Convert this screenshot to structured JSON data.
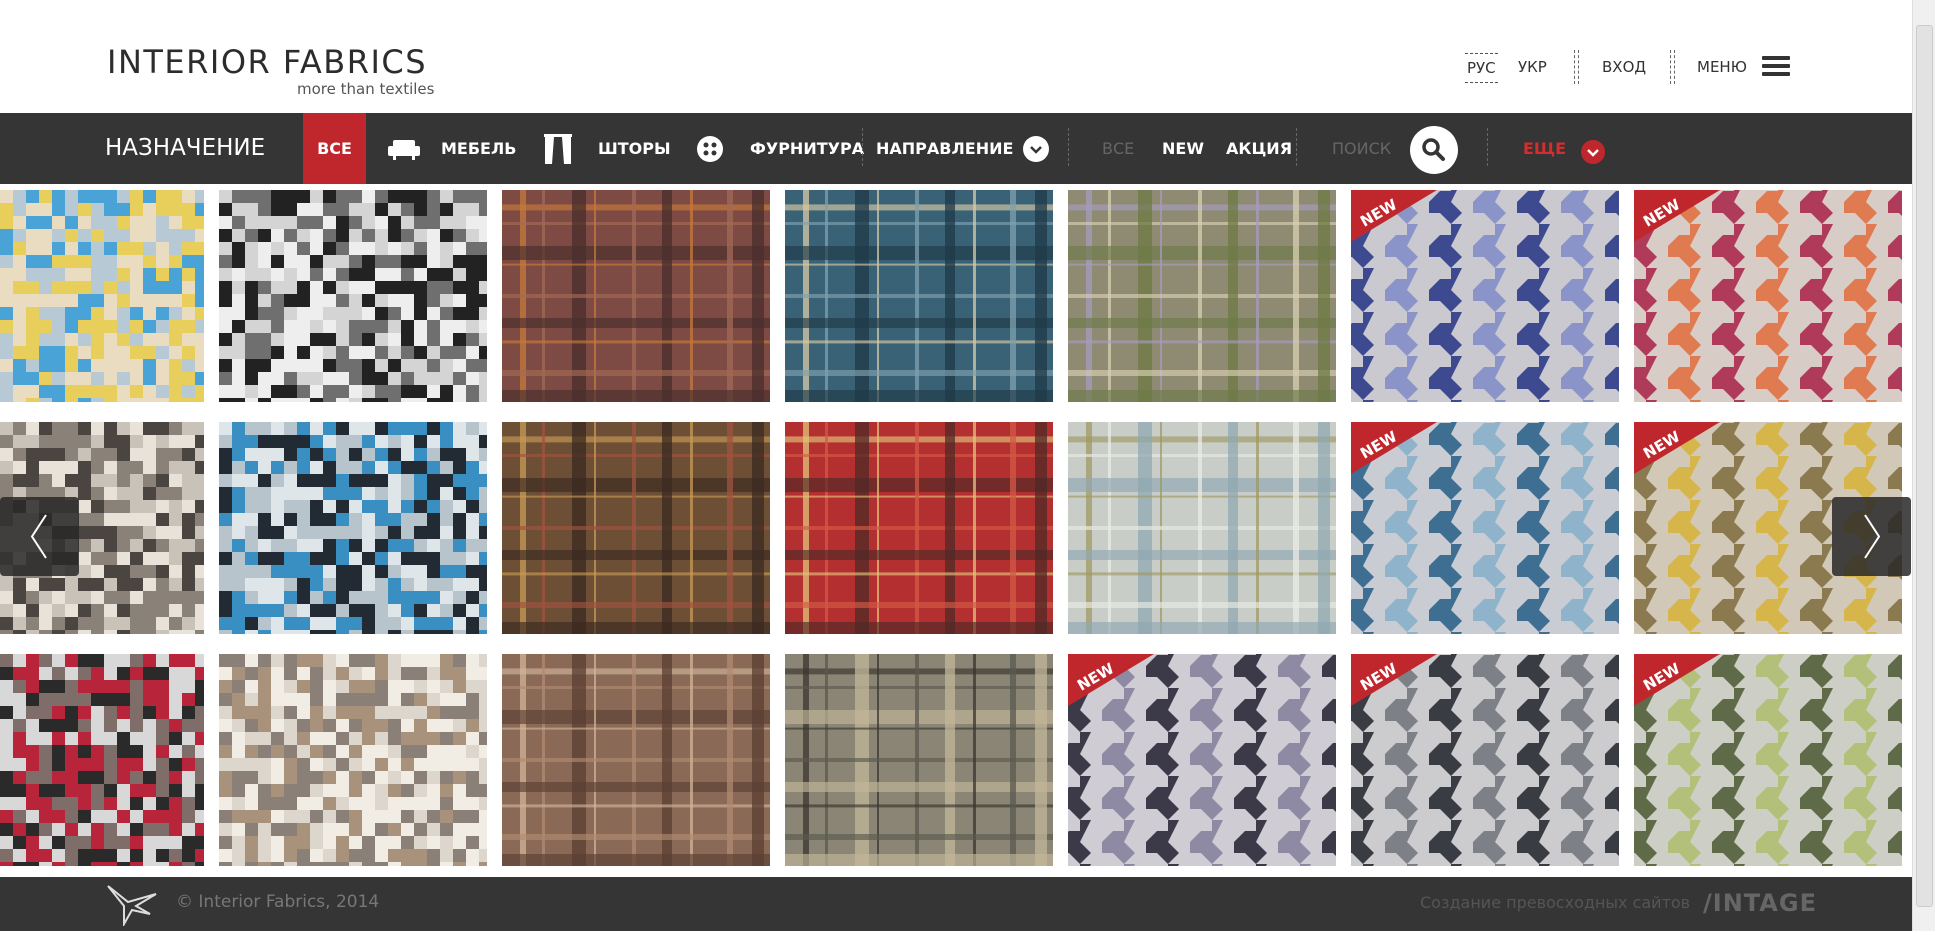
{
  "header": {
    "logo_title": "INTERIOR FABRICS",
    "logo_subtitle": "more than textiles",
    "lang_ru": "РУС",
    "lang_ua": "УКР",
    "login": "ВХОД",
    "menu": "МЕНЮ"
  },
  "nav": {
    "title": "НАЗНАЧЕНИЕ",
    "all": "ВСЕ",
    "furniture": "МЕБЕЛЬ",
    "curtains": "ШТОРЫ",
    "hardware": "ФУРНИТУРА",
    "direction": "НАПРАВЛЕНИЕ",
    "filter_all": "ВСЕ",
    "filter_new": "NEW",
    "filter_sale": "АКЦИЯ",
    "search_placeholder": "ПОИСК",
    "more": "ЕЩЕ"
  },
  "colors": {
    "accent": "#c0272d",
    "nav_bg": "#353535"
  },
  "products": [
    {
      "pattern": "pixel",
      "colors": [
        "#e9dcc0",
        "#4aa3d6",
        "#e8cf5c",
        "#b8c9d6"
      ],
      "new": false
    },
    {
      "pattern": "pixel",
      "colors": [
        "#d4d4d4",
        "#222222",
        "#6f6f6f",
        "#eeeeee"
      ],
      "new": false
    },
    {
      "pattern": "plaid",
      "colors": [
        "#7e4a44",
        "#c77a3a",
        "#4a2e2c",
        "#a36a55"
      ],
      "new": false
    },
    {
      "pattern": "plaid",
      "colors": [
        "#3a6277",
        "#d7c9a5",
        "#1f3a47",
        "#7fa1ad"
      ],
      "new": false
    },
    {
      "pattern": "plaid",
      "colors": [
        "#8f8a72",
        "#a49cbf",
        "#6d7a46",
        "#d8cfb0"
      ],
      "new": false
    },
    {
      "pattern": "houndstooth",
      "colors": [
        "#c9c9cf",
        "#3e4a8f",
        "#8a94c8"
      ],
      "new": true
    },
    {
      "pattern": "houndstooth",
      "colors": [
        "#d8ccc6",
        "#b03a5a",
        "#e07a50"
      ],
      "new": true
    },
    {
      "pattern": "pixel",
      "colors": [
        "#c9c2b8",
        "#4a4540",
        "#8a8178",
        "#e8e2d8"
      ],
      "new": false
    },
    {
      "pattern": "pixel",
      "colors": [
        "#b8c4cc",
        "#3a8fc2",
        "#222a33",
        "#dfe6ea"
      ],
      "new": false
    },
    {
      "pattern": "plaid",
      "colors": [
        "#6d4f35",
        "#c79a55",
        "#3b2a22",
        "#a0533f"
      ],
      "new": false
    },
    {
      "pattern": "plaid",
      "colors": [
        "#b43030",
        "#e3c27a",
        "#4f2a26",
        "#d25a46"
      ],
      "new": false
    },
    {
      "pattern": "plaid",
      "colors": [
        "#c9cdc8",
        "#9e9a62",
        "#8fa8b2",
        "#e9ebe5"
      ],
      "new": false
    },
    {
      "pattern": "houndstooth",
      "colors": [
        "#c9ccd3",
        "#3e6f92",
        "#8fb3cb"
      ],
      "new": true
    },
    {
      "pattern": "houndstooth",
      "colors": [
        "#d2c8b8",
        "#8b7a4f",
        "#d6b54a"
      ],
      "new": true
    },
    {
      "pattern": "pixel",
      "colors": [
        "#d8d8d8",
        "#b8243a",
        "#2a2a2a",
        "#7f6d6a"
      ],
      "new": false
    },
    {
      "pattern": "pixel",
      "colors": [
        "#ddd6cc",
        "#a8927c",
        "#f2ede4",
        "#8a8078"
      ],
      "new": false
    },
    {
      "pattern": "plaid",
      "colors": [
        "#8a6a56",
        "#d0b49a",
        "#5a3f33",
        "#b08a70"
      ],
      "new": false
    },
    {
      "pattern": "plaid",
      "colors": [
        "#8a8574",
        "#3a3530",
        "#c2b79a",
        "#5a5a50"
      ],
      "new": false
    },
    {
      "pattern": "houndstooth",
      "colors": [
        "#cfccd4",
        "#3c3a48",
        "#8e8aa3"
      ],
      "new": true
    },
    {
      "pattern": "houndstooth",
      "colors": [
        "#cccccf",
        "#3a3c44",
        "#7e8088"
      ],
      "new": true
    },
    {
      "pattern": "houndstooth",
      "colors": [
        "#cdcfc6",
        "#5e6a48",
        "#b3c079"
      ],
      "new": true
    }
  ],
  "new_label": "NEW",
  "footer": {
    "copyright": "© Interior Fabrics, 2014",
    "credit": "Создание превосходных сайтов",
    "brand": "/INTAGE"
  }
}
